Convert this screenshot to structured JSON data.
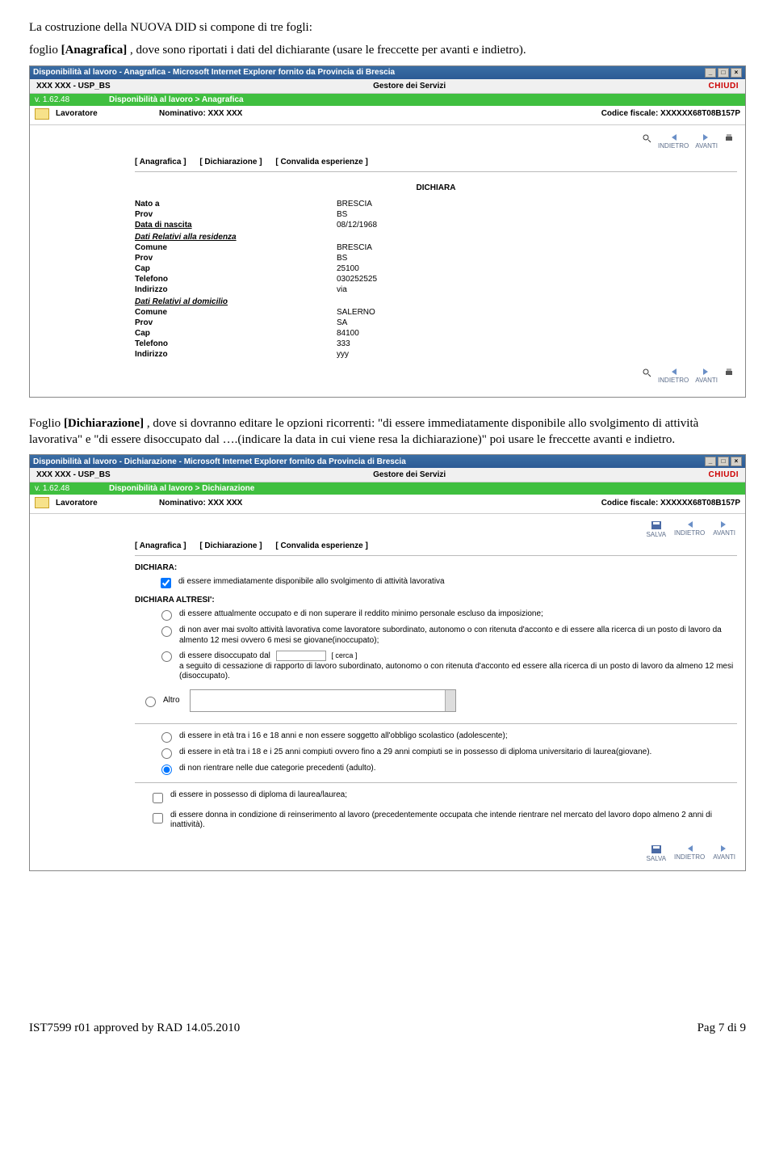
{
  "intro": {
    "line1_a": "La costruzione della NUOVA DID si compone di tre fogli:",
    "line2_pre": "foglio ",
    "line2_bold": "[Anagrafica]",
    "line2_post": " , dove sono riportati i dati del dichiarante (usare le freccette per avanti e indietro)."
  },
  "shot1": {
    "title": "Disponibilità al lavoro - Anagrafica - Microsoft Internet Explorer fornito da Provincia di Brescia",
    "user": "XXX XXX - USP_BS",
    "role": "Gestore dei Servizi",
    "chiudi": "CHIUDI",
    "version": "v. 1.62.48",
    "crumb": "Disponibilità al lavoro > Anagrafica",
    "lavoratore": "Lavoratore",
    "nominativo_label": "Nominativo: XXX  XXX",
    "cf_label": "Codice fiscale:  XXXXXX68T08B157P",
    "tabs": {
      "a": "[ Anagrafica ]",
      "b": "[ Dichiarazione ]",
      "c": "[ Convalida esperienze ]"
    },
    "dichiara": "DICHIARA",
    "rows": {
      "nato_a_k": "Nato a",
      "nato_a_v": "BRESCIA",
      "prov1_k": "Prov",
      "prov1_v": "BS",
      "datan_k": "Data di nascita",
      "datan_v": "08/12/1968",
      "res_head": "Dati Relativi alla residenza",
      "comune1_k": "Comune",
      "comune1_v": "BRESCIA",
      "prov2_k": "Prov",
      "prov2_v": "BS",
      "cap1_k": "Cap",
      "cap1_v": "25100",
      "tel1_k": "Telefono",
      "tel1_v": "030252525",
      "ind1_k": "Indirizzo",
      "ind1_v": "via",
      "dom_head": "Dati Relativi al domicilio",
      "comune2_k": "Comune",
      "comune2_v": "SALERNO",
      "prov3_k": "Prov",
      "prov3_v": "SA",
      "cap2_k": "Cap",
      "cap2_v": "84100",
      "tel2_k": "Telefono",
      "tel2_v": "333",
      "ind2_k": "Indirizzo",
      "ind2_v": "yyy"
    },
    "tool_indietro": "INDIETRO",
    "tool_avanti": "AVANTI"
  },
  "mid": {
    "pre": "Foglio ",
    "bold": "[Dichiarazione]",
    "post": " , dove si dovranno editare le opzioni ricorrenti: \"di essere immediatamente disponibile allo svolgimento di attività lavorativa\" e \"di essere disoccupato dal ….(indicare la data in cui viene resa la dichiarazione)\" poi usare le freccette avanti e indietro."
  },
  "shot2": {
    "title": "Disponibilità al lavoro - Dichiarazione - Microsoft Internet Explorer fornito da Provincia di Brescia",
    "user": "XXX XXX - USP_BS",
    "role": "Gestore dei Servizi",
    "chiudi": "CHIUDI",
    "version": "v. 1.62.48",
    "crumb": "Disponibilità al lavoro > Dichiarazione",
    "lavoratore": "Lavoratore",
    "nominativo_label": "Nominativo: XXX  XXX",
    "cf_label": "Codice fiscale:  XXXXXX68T08B157P",
    "tabs": {
      "a": "[ Anagrafica ]",
      "b": "[ Dichiarazione ]",
      "c": "[ Convalida esperienze ]"
    },
    "dichiara": "DICHIARA:",
    "chk1": "di essere immediatamente disponibile allo svolgimento di attività lavorativa",
    "dichiara_altresi": "DICHIARA ALTRESI':",
    "opt1": "di essere attualmente occupato e di non superare il reddito minimo personale escluso da imposizione;",
    "opt2": "di non aver mai svolto attività lavorativa come lavoratore subordinato, autonomo o con ritenuta d'acconto e di essere alla ricerca di un posto di lavoro da almento 12 mesi ovvero 6 mesi se giovane(inoccupato);",
    "opt3_pre": "di essere disoccupato dal",
    "opt3_cerca": "[ cerca ]",
    "opt3_post": "a seguito di cessazione di rapporto di lavoro subordinato, autonomo o con ritenuta d'acconto ed essere alla ricerca di un posto di lavoro da almeno 12 mesi (disoccupato).",
    "opt_altro": "Altro",
    "opt4": "di essere in età tra i 16 e 18 anni e non essere soggetto all'obbligo scolastico (adolescente);",
    "opt5": "di essere in età tra i 18 e i 25 anni compiuti ovvero fino a 29 anni compiuti se in possesso di diploma universitario di laurea(giovane).",
    "opt6": "di non rientrare nelle due categorie precedenti (adulto).",
    "chk2": "di essere in possesso di diploma di laurea/laurea;",
    "chk3": "di essere donna in condizione di reinserimento al lavoro (precedentemente occupata che intende rientrare nel mercato del lavoro dopo almeno 2 anni di inattività).",
    "tool_salva": "SALVA",
    "tool_indietro": "INDIETRO",
    "tool_avanti": "AVANTI"
  },
  "footer": {
    "left": "IST7599 r01 approved by RAD 14.05.2010",
    "right": "Pag 7 di 9"
  }
}
